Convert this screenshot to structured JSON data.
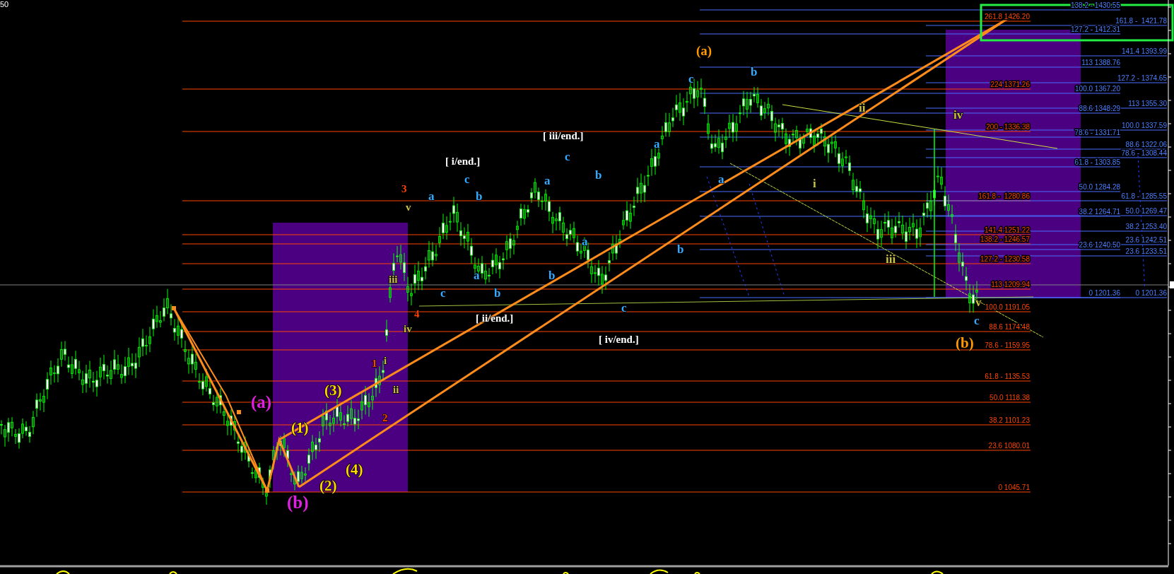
{
  "corner_label": "50",
  "fib_red": [
    "261.8 1426.20",
    "224 1371.26",
    "200 - 1336.38",
    "161.8 -  1280.86",
    "141.4 1251.22",
    "138.2 - 1246.57",
    "127.2 - 1230.58",
    "113 1209.94",
    "100.0 1191.05",
    "88.6 1174.48",
    "78.6 - 1159.95",
    "61.8 - 1135.53",
    "50.0 1118.38",
    "38.2 1101.23",
    "23.6 1080.01",
    "0 1045.71"
  ],
  "fib_blue_inner": [
    "138.2 - 1430.55",
    "127.2 - 1412.31",
    "113 1388.76",
    "100.0 1367.20",
    "88.6 1348.29",
    "78.6 - 1331.71",
    "61.8 - 1303.85",
    "50.0 1284.28",
    "38.2 1264.71",
    "23.6 1240.50",
    "0 1201.36"
  ],
  "fib_blue_outer": [
    "161.8 -  1421.78",
    "141.4 1393.99",
    "127.2 - 1374.65",
    "113 1355.30",
    "100.0 1337.59",
    "88.6 1322.06",
    "78.6 - 1308.44",
    "61.8 - 1285.55",
    "50.0 1269.47",
    "38.2 1253.40",
    "23.6 1242.51",
    "23.6 1233.51",
    "0 1201.36"
  ],
  "wave_labels": [
    {
      "text": "(a)",
      "color": "#ff9900"
    },
    {
      "text": "c",
      "color": "#33aaff"
    },
    {
      "text": "b",
      "color": "#33aaff"
    },
    {
      "text": "[ iii/end.]",
      "color": "#ffffff"
    },
    {
      "text": "[ i/end.]",
      "color": "#ffffff"
    },
    {
      "text": "c",
      "color": "#33aaff"
    },
    {
      "text": "b",
      "color": "#33aaff"
    },
    {
      "text": "c",
      "color": "#33aaff"
    },
    {
      "text": "b",
      "color": "#33aaff"
    },
    {
      "text": "a",
      "color": "#33aaff"
    },
    {
      "text": "a",
      "color": "#33aaff"
    },
    {
      "text": "a",
      "color": "#33aaff"
    },
    {
      "text": "a",
      "color": "#33aaff"
    },
    {
      "text": "a",
      "color": "#33aaff"
    },
    {
      "text": "b",
      "color": "#33aaff"
    },
    {
      "text": "c",
      "color": "#33aaff"
    },
    {
      "text": "b",
      "color": "#33aaff"
    },
    {
      "text": "b",
      "color": "#33aaff"
    },
    {
      "text": "c",
      "color": "#33aaff"
    },
    {
      "text": "a",
      "color": "#33aaff"
    },
    {
      "text": "3",
      "color": "#ff4400"
    },
    {
      "text": "v",
      "color": "#c8c040"
    },
    {
      "text": "iii",
      "color": "#c8c040"
    },
    {
      "text": "4",
      "color": "#ff4400"
    },
    {
      "text": "iv",
      "color": "#c8c040"
    },
    {
      "text": "1",
      "color": "#ff4400"
    },
    {
      "text": "i",
      "color": "#c8c040"
    },
    {
      "text": "ii",
      "color": "#c8c040"
    },
    {
      "text": "2",
      "color": "#ff4400"
    },
    {
      "text": "[ ii/end.]",
      "color": "#ffffff"
    },
    {
      "text": "[ iv/end.]",
      "color": "#ffffff"
    },
    {
      "text": "(a)",
      "color": "#e020e0"
    },
    {
      "text": "(b)",
      "color": "#e020e0"
    },
    {
      "text": "(1)",
      "color": "#ffd700"
    },
    {
      "text": "(3)",
      "color": "#ffd700"
    },
    {
      "text": "(4)",
      "color": "#ffd700"
    },
    {
      "text": "(2)",
      "color": "#ffd700"
    },
    {
      "text": "ii",
      "color": "#c8c040"
    },
    {
      "text": "i",
      "color": "#c8c040"
    },
    {
      "text": "iii",
      "color": "#c8c040"
    },
    {
      "text": "iv",
      "color": "#c8c040"
    },
    {
      "text": "v",
      "color": "#c8c040"
    },
    {
      "text": "c",
      "color": "#33aaff"
    },
    {
      "text": "(b)",
      "color": "#ff9900"
    }
  ]
}
